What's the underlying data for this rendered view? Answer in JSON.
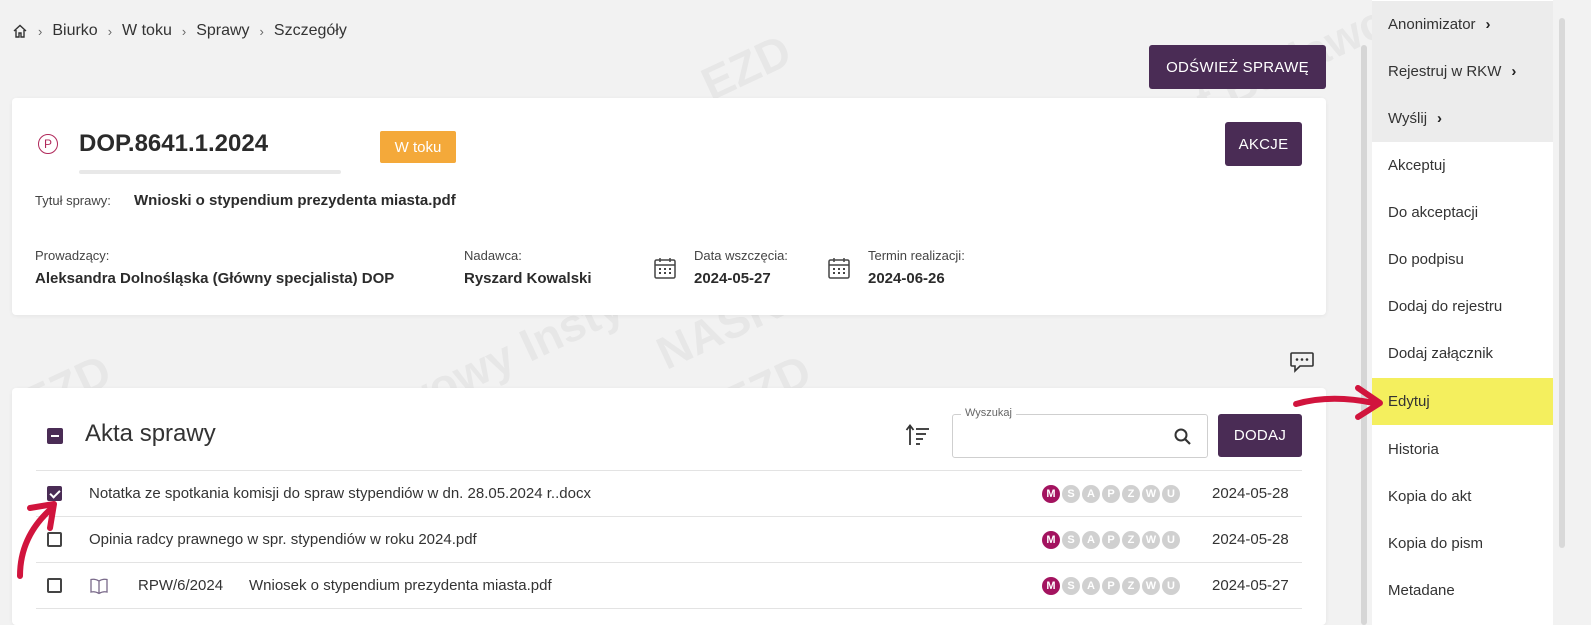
{
  "breadcrumb": {
    "items": [
      "Biurko",
      "W toku",
      "Sprawy",
      "Szczegóły"
    ]
  },
  "refresh_button": "ODŚWIEŻ SPRAWĘ",
  "case": {
    "icon_letter": "P",
    "number": "DOP.8641.1.2024",
    "status": "W toku",
    "actions_button": "AKCJE",
    "title_label": "Tytuł sprawy:",
    "title_value": "Wnioski o stypendium prezydenta miasta.pdf",
    "lead_label": "Prowadzący:",
    "lead_value": "Aleksandra Dolnośląska (Główny specjalista) DOP",
    "sender_label": "Nadawca:",
    "sender_value": "Ryszard Kowalski",
    "start_label": "Data wszczęcia:",
    "start_value": "2024-05-27",
    "deadline_label": "Termin realizacji:",
    "deadline_value": "2024-06-26"
  },
  "acts": {
    "title": "Akta sprawy",
    "search_legend": "Wyszukaj",
    "search_value": "",
    "add_button": "DODAJ",
    "badge_letters": [
      "M",
      "S",
      "A",
      "P",
      "Z",
      "W",
      "U"
    ],
    "rows": [
      {
        "checked": true,
        "ref": "",
        "name": "Notatka ze spotkania komisji do spraw stypendiów w dn. 28.05.2024 r..docx",
        "date": "2024-05-28"
      },
      {
        "checked": false,
        "ref": "",
        "name": "Opinia radcy prawnego w spr. stypendiów w roku 2024.pdf",
        "date": "2024-05-28"
      },
      {
        "checked": false,
        "ref": "RPW/6/2024",
        "name": "Wniosek o stypendium prezydenta miasta.pdf",
        "date": "2024-05-27"
      }
    ]
  },
  "side_menu": {
    "items": [
      {
        "label": "Anonimizator",
        "submenu": true
      },
      {
        "label": "Rejestruj w RKW",
        "submenu": true
      },
      {
        "label": "Wyślij",
        "submenu": true
      },
      {
        "label": "Akceptuj",
        "submenu": false
      },
      {
        "label": "Do akceptacji",
        "submenu": false
      },
      {
        "label": "Do podpisu",
        "submenu": false
      },
      {
        "label": "Dodaj do rejestru",
        "submenu": false
      },
      {
        "label": "Dodaj załącznik",
        "submenu": false
      },
      {
        "label": "Edytuj",
        "submenu": false,
        "highlighted": true
      },
      {
        "label": "Historia",
        "submenu": false
      },
      {
        "label": "Kopia do akt",
        "submenu": false
      },
      {
        "label": "Kopia do pism",
        "submenu": false
      },
      {
        "label": "Metadane",
        "submenu": false
      }
    ]
  },
  "colors": {
    "primary": "#4a2c55",
    "status_badge": "#f4a93a",
    "active_badge": "#a3135f",
    "highlight": "#f4ef5e",
    "annotation_arrow": "#d1143d"
  },
  "watermark": [
    "EZD",
    "NASK – Państwowy Instytut Badawczy",
    "RP"
  ]
}
